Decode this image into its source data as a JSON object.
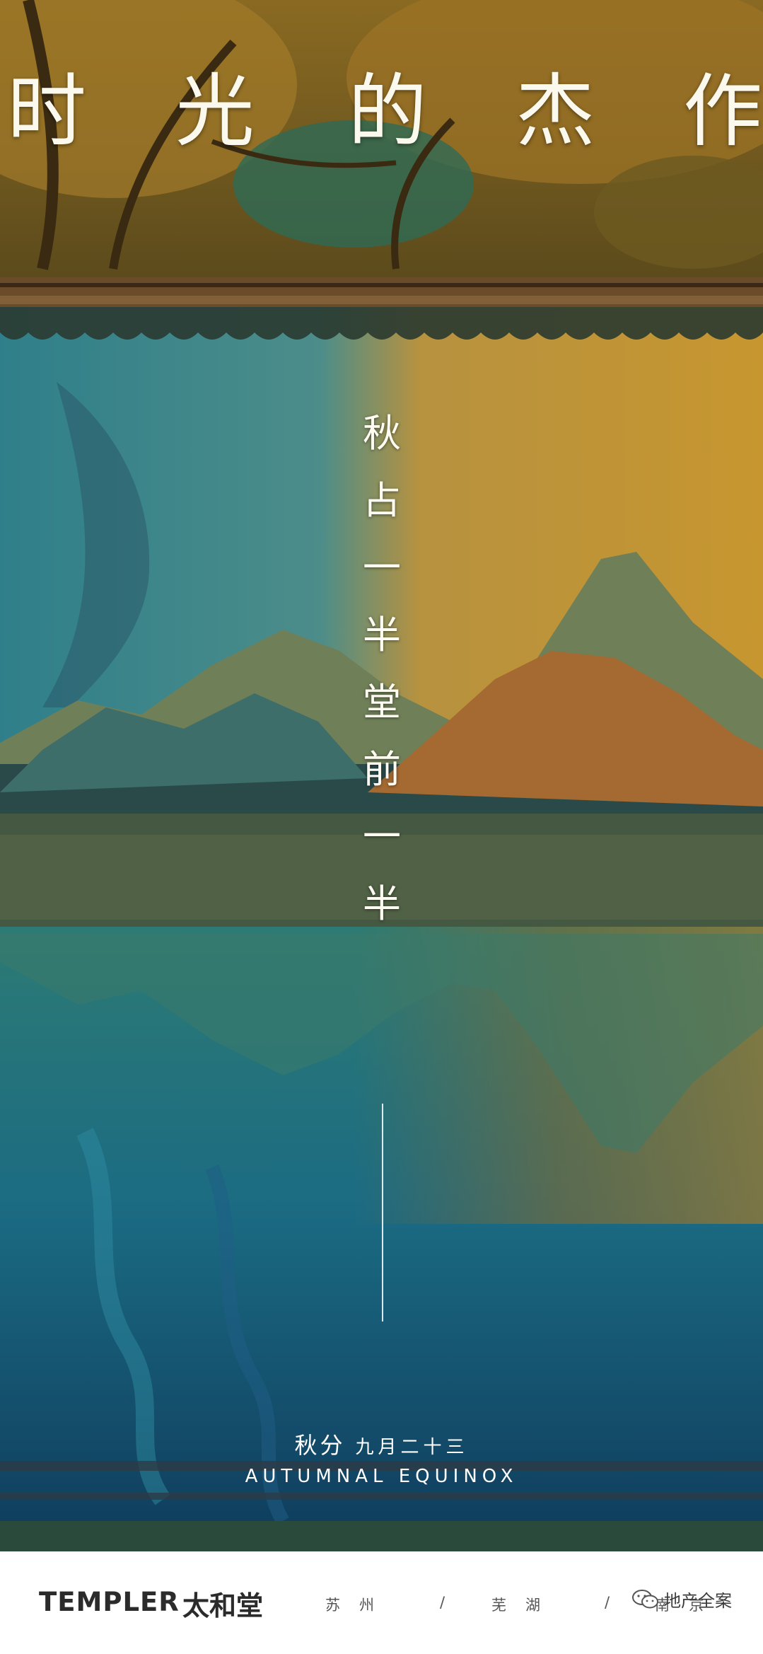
{
  "poster": {
    "title_chars": [
      "时",
      "光",
      "的",
      "杰",
      "作"
    ],
    "vertical_chars": [
      "秋",
      "占",
      "一",
      "半",
      "堂",
      "前",
      "一",
      "半"
    ],
    "solar_term": "秋分",
    "date": "九月二十三",
    "english": "AUTUMNAL EQUINOX"
  },
  "footer": {
    "brand_en": "TEMPLER",
    "brand_cn": "太和堂",
    "cities": [
      "苏",
      "州",
      "/",
      "芜",
      "湖",
      "/",
      "南",
      "京"
    ]
  },
  "watermark": {
    "text": "地产全案",
    "icon": "wechat-icon"
  },
  "colors": {
    "gold": "#b8862e",
    "teal": "#1e6f7a",
    "deep_blue": "#0f3a5a",
    "brand_text": "#2b2b2b"
  }
}
